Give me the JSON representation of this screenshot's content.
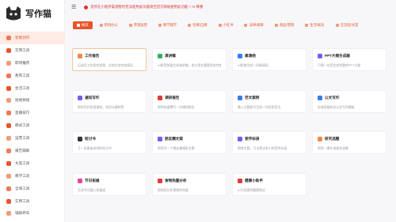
{
  "app": {
    "title": "写作猫"
  },
  "topbar": {
    "notice": "您所在小程序渠道暂时无法使用此功能请至官方网站使用此功能 + AI 降重"
  },
  "sidebar": {
    "items": [
      "智能创作",
      "实用工具",
      "职场推荐",
      "教育工具",
      "生活工具",
      "短视频组",
      "直播技巧",
      "模式工具",
      "运营工具",
      "报告辅助",
      "文案工具",
      "教学工具",
      "全域工具",
      "实用工具",
      "辅助养车"
    ]
  },
  "tabs": [
    "推荐",
    "职场办公",
    "营销运营",
    "教学辅学",
    "社媒/自媒",
    "小红书",
    "法律/规章",
    "商品/营销",
    "生活/娱乐",
    "全流程/文案"
  ],
  "cards": [
    {
      "title": "工作报告",
      "desc": "记录员工阶段性成果，总结任务完成情况",
      "color": "#f08a4b"
    },
    {
      "title": "演讲稿",
      "desc": "AI帮您快速生成演讲稿，助力您在重要场合完美发挥",
      "color": "#31b06a"
    },
    {
      "title": "邀请函",
      "desc": "AI智能生成一份邀请函",
      "color": "#3a7bf2"
    },
    {
      "title": "PPT大纲生成器",
      "desc": "只需一句话生成完整的PPT大纲",
      "color": "#7c5cf0"
    },
    {
      "title": "通知写作",
      "desc": "帮你写好各类通知，如活动通知等",
      "color": "#7c5cf0"
    },
    {
      "title": "调研报告",
      "desc": "帮你快速撰写一份调研报告",
      "color": "#e03b3b"
    },
    {
      "title": "范文案例",
      "desc": "输入主题即可生成一份优质范文",
      "color": "#3a7bf2"
    },
    {
      "title": "公文写作",
      "desc": "标准党政机关公文写作模板",
      "color": "#3a7bf2"
    },
    {
      "title": "检讨书",
      "desc": "写一份真诚深刻的检讨书",
      "color": "#333333"
    },
    {
      "title": "朋友圈文案",
      "desc": "帮您写一个朋友圈精彩文案",
      "color": "#7c5cf0"
    },
    {
      "title": "宣传标语",
      "desc": "提炼主题，写出简洁有力的宣传标语",
      "color": "#7c5cf0"
    },
    {
      "title": "研究选题",
      "desc": "帮您一键生成研究选题",
      "color": "#f08a4b"
    },
    {
      "title": "节日祝福",
      "desc": "生成节日暖心祝福语",
      "color": "#e04aa0"
    },
    {
      "title": "食物热量分析",
      "desc": "帮助您分析食物的热量",
      "color": "#e03b3b"
    },
    {
      "title": "健康小助手",
      "desc": "AI为您提供健康建议",
      "color": "#e03b3b"
    }
  ]
}
